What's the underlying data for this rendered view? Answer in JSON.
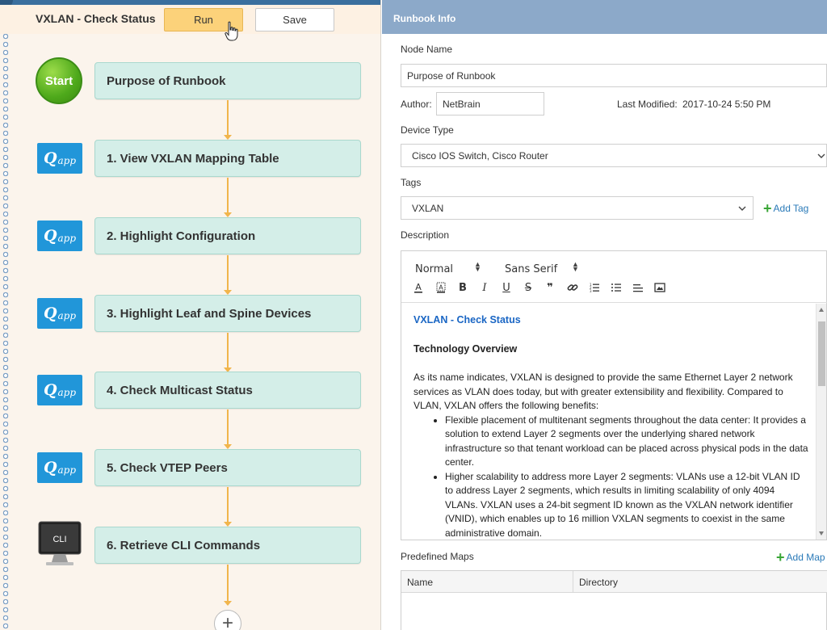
{
  "runbook": {
    "title": "VXLAN - Check Status",
    "run_label": "Run",
    "save_label": "Save",
    "start_label": "Start",
    "nodes": [
      {
        "label": "Purpose of Runbook",
        "icon": "start-icon"
      },
      {
        "label": "1. View VXLAN Mapping Table",
        "icon": "qapp-icon"
      },
      {
        "label": "2. Highlight Configuration",
        "icon": "qapp-icon"
      },
      {
        "label": "3. Highlight Leaf and Spine Devices",
        "icon": "qapp-icon"
      },
      {
        "label": "4. Check Multicast Status",
        "icon": "qapp-icon"
      },
      {
        "label": "5. Check VTEP Peers",
        "icon": "qapp-icon"
      },
      {
        "label": "6. Retrieve CLI Commands",
        "icon": "cli-icon"
      }
    ],
    "qapp_q": "Q",
    "qapp_app": "app",
    "cli_label": "CLI",
    "add_node_label": "+",
    "colors": {
      "node_bg": "#d4eee8",
      "connector": "#f1b54c",
      "qapp": "#2196d9",
      "run": "#fcd27a"
    }
  },
  "info": {
    "header_title": "Runbook Info",
    "node_name_label": "Node Name",
    "node_name_value": "Purpose of Runbook",
    "author_label": "Author:",
    "author_value": "NetBrain",
    "last_modified_label": "Last Modified:",
    "last_modified_value": "2017-10-24 5:50 PM",
    "device_type_label": "Device Type",
    "device_type_value": "Cisco IOS Switch, Cisco Router",
    "tags_label": "Tags",
    "tags_value": "VXLAN",
    "add_tag_label": "Add Tag",
    "description_label": "Description",
    "predefined_maps_label": "Predefined Maps",
    "add_map_label": "Add Map",
    "maps_columns": [
      "Name",
      "Directory"
    ]
  },
  "editor": {
    "format_value": "Normal",
    "font_value": "Sans Serif",
    "toolbar_icons": [
      "font-color-icon",
      "highlight-icon",
      "bold-icon",
      "italic-icon",
      "underline-icon",
      "strike-icon",
      "quote-icon",
      "link-icon",
      "ordered-list-icon",
      "bullet-list-icon",
      "align-icon",
      "image-icon"
    ],
    "toolbar_glyphs": {
      "bold": "B",
      "italic": "I",
      "underline": "U",
      "strike": "S",
      "quote": "❞"
    },
    "doc_title": "VXLAN - Check Status",
    "doc_section": "Technology Overview",
    "doc_intro": "As its name indicates, VXLAN is designed to provide the same Ethernet Layer 2 network services as VLAN does today, but with greater extensibility and flexibility. Compared to VLAN, VXLAN offers the following benefits:",
    "doc_bullets": [
      "Flexible placement of multitenant segments throughout the data center: It provides a solution to extend Layer 2 segments over the underlying shared network infrastructure so that tenant workload can be placed across physical pods in the data center.",
      "Higher scalability to address more Layer 2 segments: VLANs use a 12-bit VLAN ID to address Layer 2 segments, which results in limiting scalability of only 4094 VLANs. VXLAN uses a 24-bit segment ID known as the VXLAN network identifier (VNID), which enables up to 16 million VXLAN segments to coexist in the same administrative domain."
    ]
  }
}
